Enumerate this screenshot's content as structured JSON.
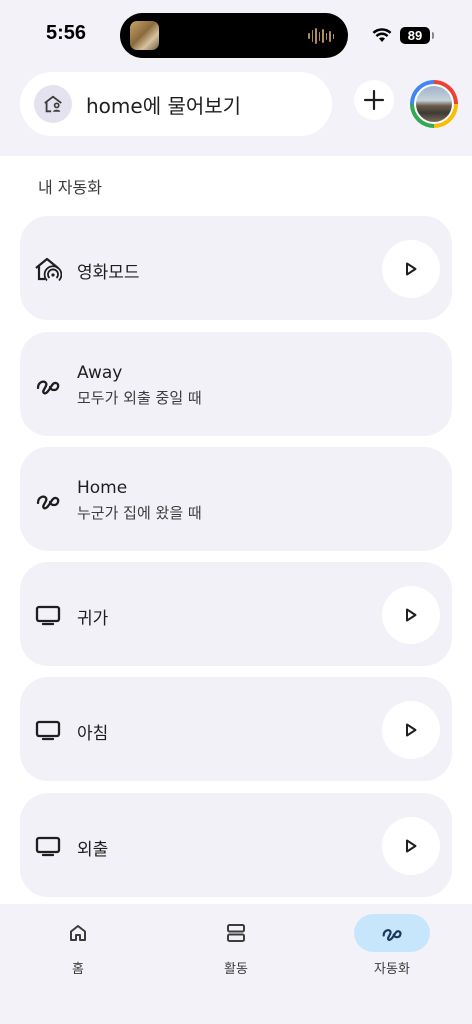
{
  "status_bar": {
    "time": "5:56",
    "battery": "89"
  },
  "header": {
    "search_text": "home에 물어보기",
    "icons": {
      "home": "home-person-icon",
      "add": "plus-icon",
      "avatar": "profile-avatar"
    }
  },
  "section_title": "내 자동화",
  "automations": [
    {
      "title": "영화모드",
      "subtitle": "",
      "icon": "home-broadcast-icon",
      "has_play": true
    },
    {
      "title": "Away",
      "subtitle": "모두가 외출 중일 때",
      "icon": "routine-squiggle-icon",
      "has_play": false
    },
    {
      "title": "Home",
      "subtitle": "누군가 집에 왔을 때",
      "icon": "routine-squiggle-icon",
      "has_play": false
    },
    {
      "title": "귀가",
      "subtitle": "",
      "icon": "tv-icon",
      "has_play": true
    },
    {
      "title": "아침",
      "subtitle": "",
      "icon": "tv-icon",
      "has_play": true
    },
    {
      "title": "외출",
      "subtitle": "",
      "icon": "tv-icon",
      "has_play": true
    }
  ],
  "bottom_nav": [
    {
      "label": "홈",
      "icon": "home-icon",
      "active": false
    },
    {
      "label": "활동",
      "icon": "activity-icon",
      "active": false
    },
    {
      "label": "자동화",
      "icon": "automation-icon",
      "active": true
    }
  ],
  "colors": {
    "background": "#f3f2f8",
    "card": "#f2f1f7",
    "active_nav": "#c8e6fb"
  }
}
